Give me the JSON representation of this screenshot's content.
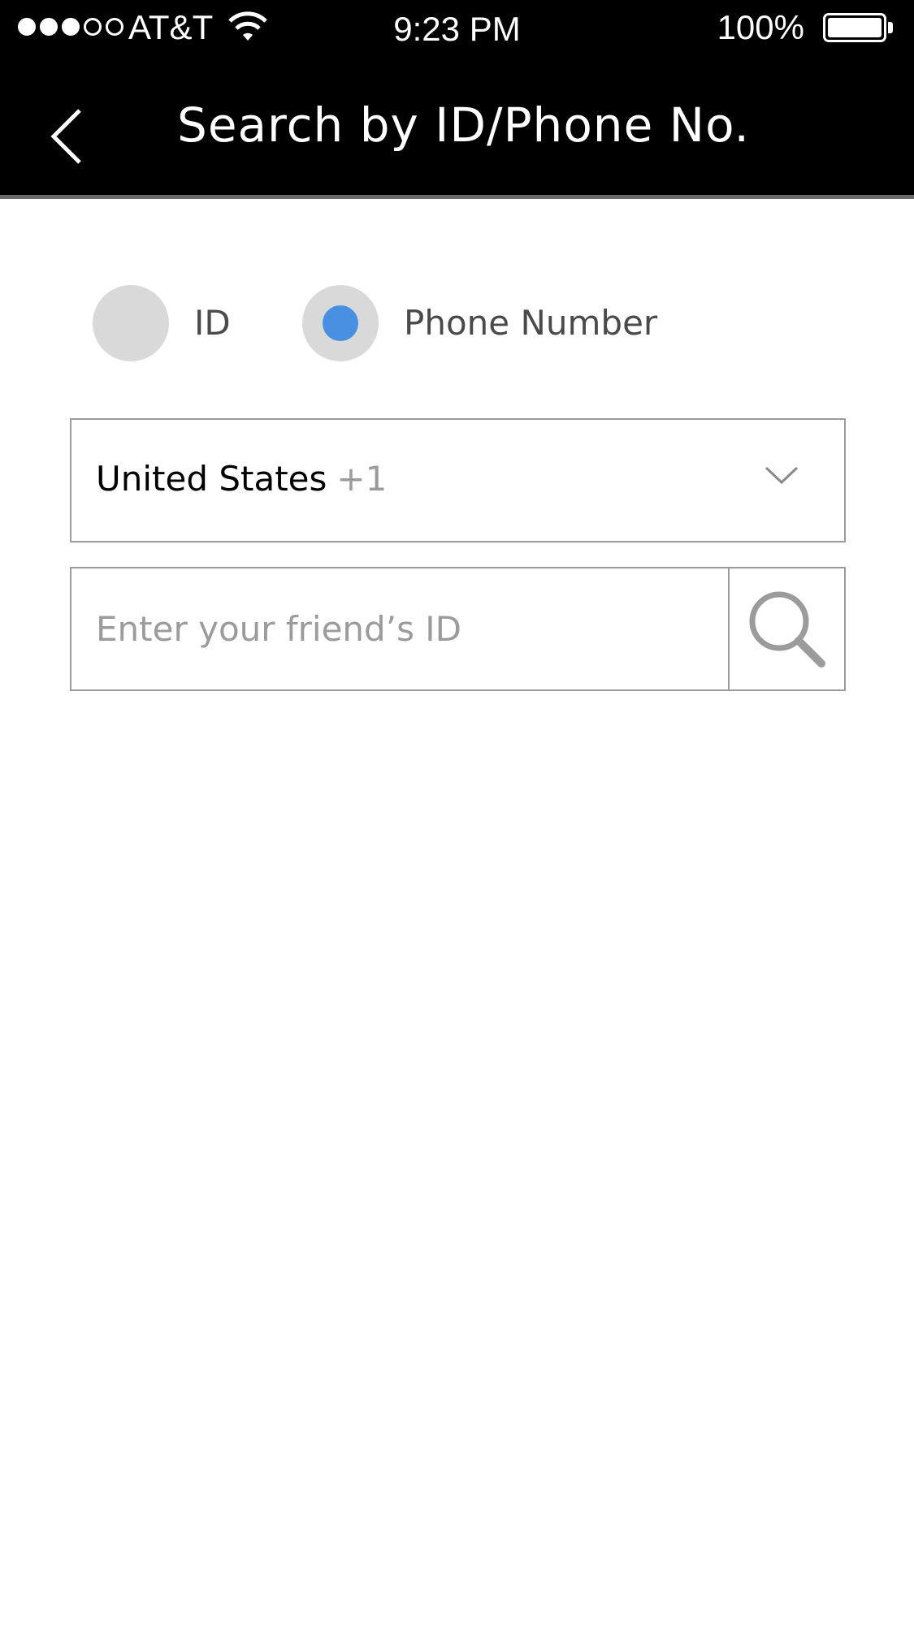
{
  "status_bar": {
    "carrier": "AT&T",
    "time": "9:23 PM",
    "battery_percent": "100%",
    "signal_bars_filled": 3,
    "signal_bars_total": 5
  },
  "header": {
    "title": "Search by ID/Phone No.",
    "back_icon": "chevron-left-icon"
  },
  "search_type": {
    "options": [
      {
        "label": "ID",
        "selected": false
      },
      {
        "label": "Phone Number",
        "selected": true
      }
    ]
  },
  "country_select": {
    "country": "United States",
    "code": "+1",
    "icon": "chevron-down-icon"
  },
  "search": {
    "placeholder": "Enter your friend’s ID",
    "value": "",
    "icon": "search-icon"
  },
  "colors": {
    "header_bg": "#000000",
    "accent": "#4a90e2",
    "radio_bg": "#d9d9d9",
    "border": "#9b9b9b",
    "placeholder": "#9b9b9b"
  }
}
